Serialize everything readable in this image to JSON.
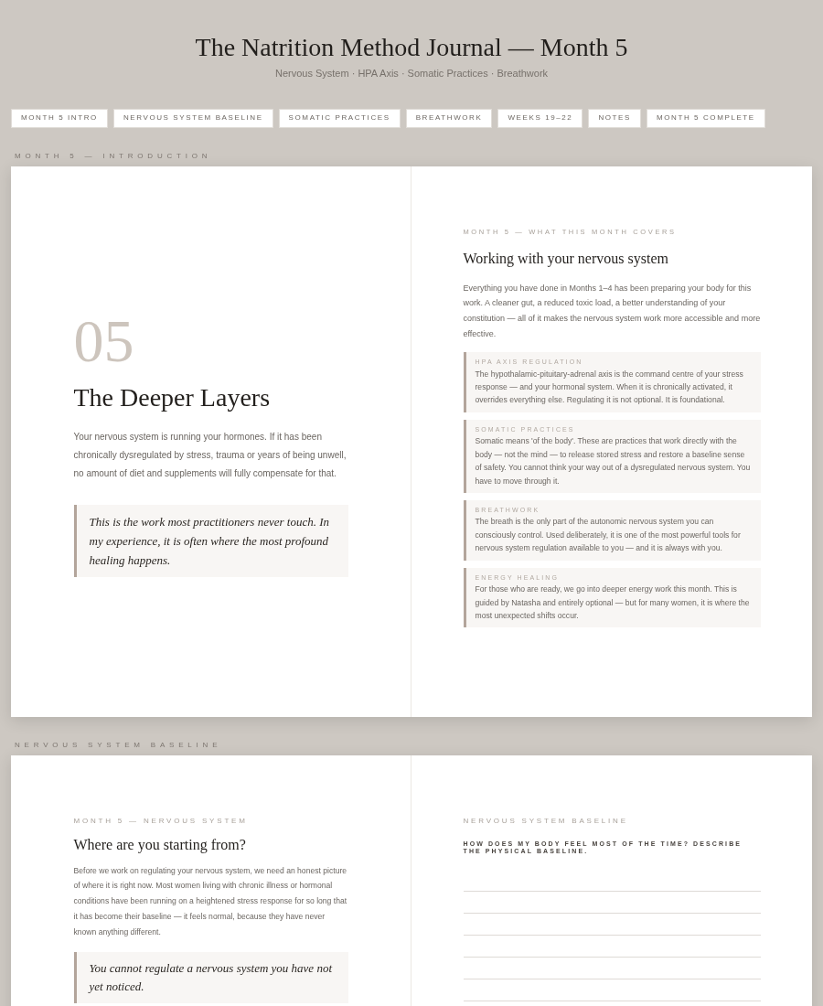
{
  "header": {
    "title": "The Natrition Method Journal — Month 5",
    "subtitle": "Nervous System · HPA Axis · Somatic Practices · Breathwork"
  },
  "nav": [
    "MONTH 5 INTRO",
    "NERVOUS SYSTEM BASELINE",
    "SOMATIC PRACTICES",
    "BREATHWORK",
    "WEEKS 19–22",
    "NOTES",
    "MONTH 5 COMPLETE"
  ],
  "sections": [
    {
      "label": "MONTH 5 — INTRODUCTION",
      "left": {
        "kind": "chapter",
        "number": "05",
        "title": "The Deeper Layers",
        "body": "Your nervous system is running your hormones. If it has been chronically dysregulated by stress, trauma or years of being unwell, no amount of diet and supplements will fully compensate for that.",
        "quote": "This is the work most practitioners never touch. In my experience, it is often where the most profound healing happens."
      },
      "right": {
        "kind": "overview",
        "eyebrow": "MONTH 5 — WHAT THIS MONTH COVERS",
        "title": "Working with your nervous system",
        "body": "Everything you have done in Months 1–4 has been preparing your body for this work. A cleaner gut, a reduced toxic load, a better understanding of your constitution — all of it makes the nervous system work more accessible and more effective.",
        "cards": [
          {
            "title": "HPA AXIS REGULATION",
            "text": "The hypothalamic-pituitary-adrenal axis is the command centre of your stress response — and your hormonal system. When it is chronically activated, it overrides everything else. Regulating it is not optional. It is foundational."
          },
          {
            "title": "SOMATIC PRACTICES",
            "text": "Somatic means 'of the body'. These are practices that work directly with the body — not the mind — to release stored stress and restore a baseline sense of safety. You cannot think your way out of a dysregulated nervous system. You have to move through it."
          },
          {
            "title": "BREATHWORK",
            "text": "The breath is the only part of the autonomic nervous system you can consciously control. Used deliberately, it is one of the most powerful tools for nervous system regulation available to you — and it is always with you."
          },
          {
            "title": "ENERGY HEALING",
            "text": "For those who are ready, we go into deeper energy work this month. This is guided by Natasha and entirely optional — but for many women, it is where the most unexpected shifts occur."
          }
        ]
      }
    },
    {
      "label": "NERVOUS SYSTEM BASELINE",
      "left": {
        "kind": "intro",
        "eyebrow": "MONTH 5 — NERVOUS SYSTEM",
        "title": "Where are you starting from?",
        "body": "Before we work on regulating your nervous system, we need an honest picture of where it is right now. Most women living with chronic illness or hormonal conditions have been running on a heightened stress response for so long that it has become their baseline — it feels normal, because they have never known anything different.",
        "quote": "You cannot regulate a nervous system you have not yet noticed."
      },
      "right": {
        "kind": "prompt",
        "eyebrow": "NERVOUS SYSTEM BASELINE",
        "question": "HOW DOES MY BODY FEEL MOST OF THE TIME? DESCRIBE THE PHYSICAL BASELINE."
      }
    }
  ]
}
